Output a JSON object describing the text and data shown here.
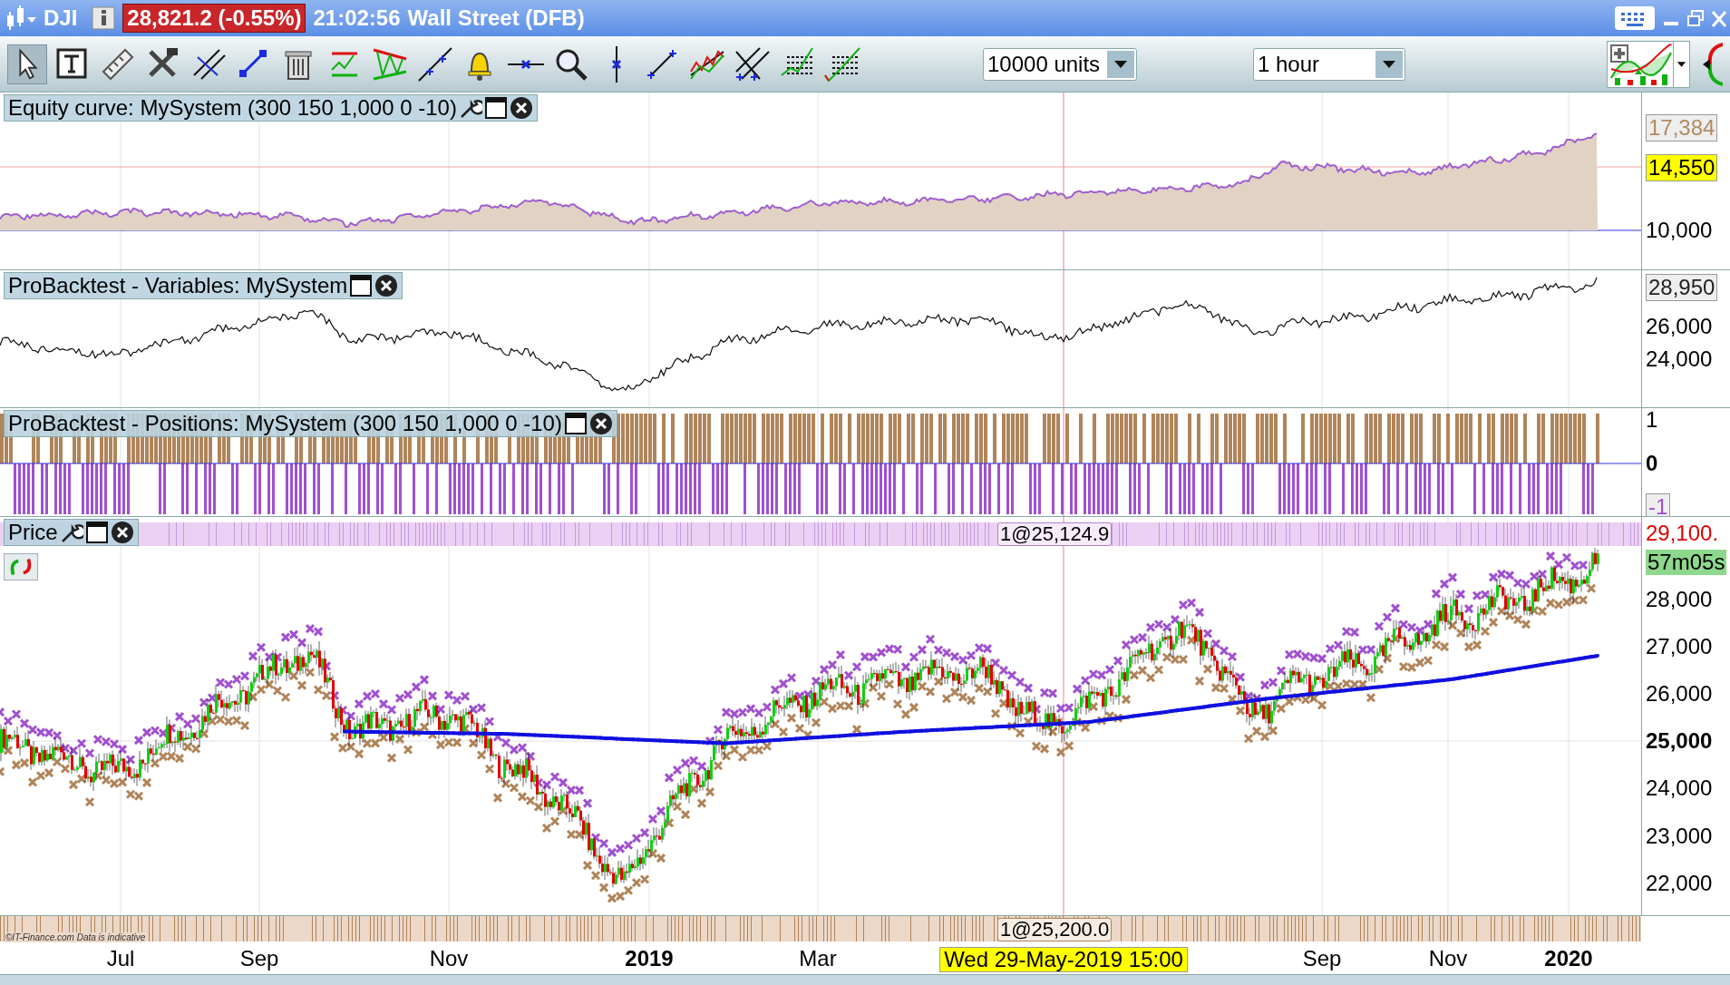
{
  "title_bar": {
    "symbol": "DJI",
    "price": "28,821.2 (-0.55%)",
    "time": "21:02:56",
    "instrument": "Wall Street (DFB)"
  },
  "toolbar": {
    "quantity": "10000 units",
    "timeframe": "1 hour"
  },
  "panels": [
    {
      "kind": "equity",
      "title": "Equity curve: MySystem (300 150 1,000 0 -10)",
      "axis": [
        "17,384",
        "14,550",
        "10,000"
      ]
    },
    {
      "kind": "variables",
      "title": "ProBacktest - Variables: MySystem",
      "axis": [
        "28,950",
        "26,000",
        "24,000"
      ]
    },
    {
      "kind": "positions",
      "title": "ProBacktest - Positions: MySystem (300 150 1,000 0 -10)",
      "axis": [
        "1",
        "0",
        "-1"
      ]
    },
    {
      "kind": "price",
      "title": "Price",
      "order_tag": "1@25,124.9",
      "axis": [
        "29,100.",
        "57m05s",
        "28,000",
        "27,000",
        "26,000",
        "25,000",
        "24,000",
        "23,000",
        "22,000"
      ]
    }
  ],
  "bottom_strip": {
    "order_tag": "1@25,200.0",
    "credit": "©IT-Finance.com Data is indicative"
  },
  "x_axis": [
    {
      "label": "Jul",
      "bold": false,
      "cursor": false
    },
    {
      "label": "Sep",
      "bold": false,
      "cursor": false
    },
    {
      "label": "Nov",
      "bold": false,
      "cursor": false
    },
    {
      "label": "2019",
      "bold": true,
      "cursor": false
    },
    {
      "label": "Mar",
      "bold": false,
      "cursor": false
    },
    {
      "label": "Wed 29-May-2019 15:00",
      "bold": false,
      "cursor": true
    },
    {
      "label": "Sep",
      "bold": false,
      "cursor": false
    },
    {
      "label": "Nov",
      "bold": false,
      "cursor": false
    },
    {
      "label": "2020",
      "bold": true,
      "cursor": false
    }
  ]
}
